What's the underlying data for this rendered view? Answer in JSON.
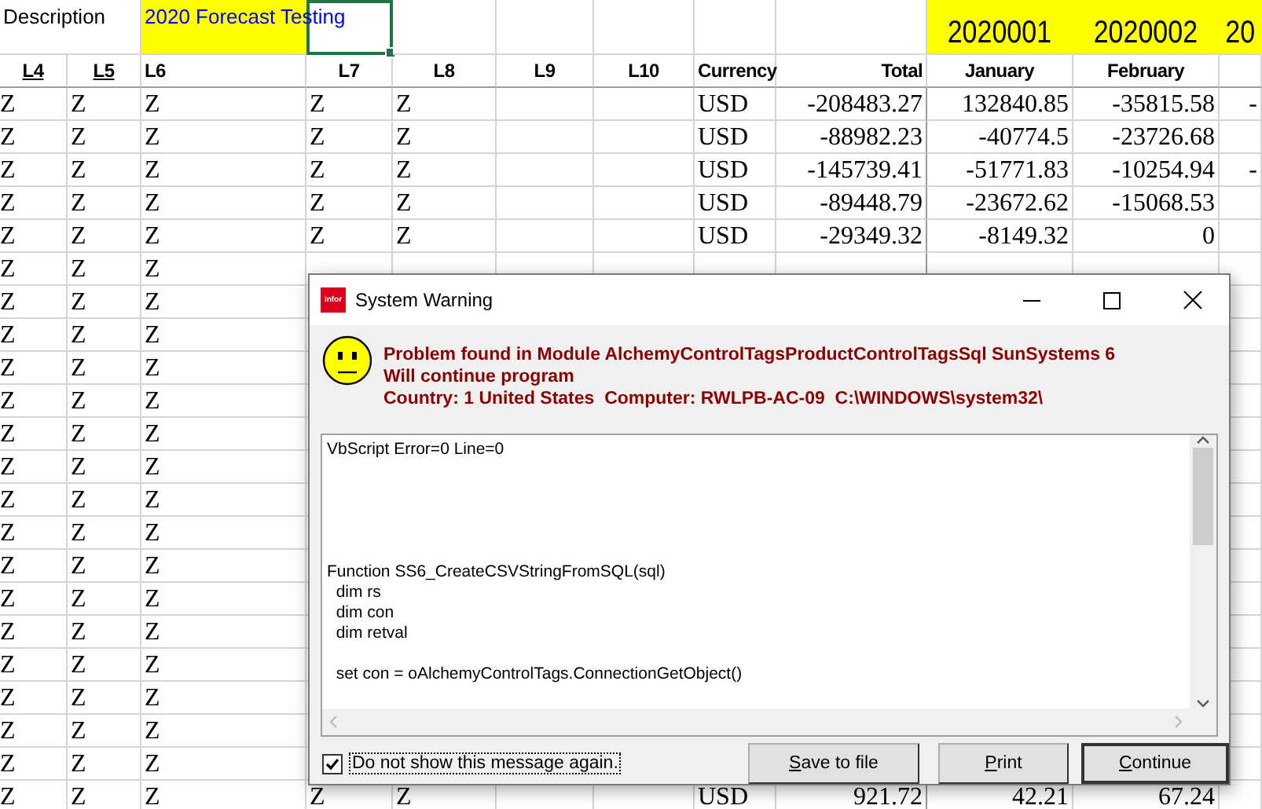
{
  "sheet": {
    "top_row": [
      {
        "text": "Description",
        "highlighted": false,
        "selected": false
      },
      {
        "text": "2020 Forecast Testing",
        "highlighted": true,
        "selected": false
      },
      {
        "highlighted": false,
        "selected": true
      },
      {
        "highlighted": false,
        "selected": false
      },
      {
        "highlighted": false,
        "selected": false
      },
      {
        "highlighted": false,
        "selected": false
      },
      {
        "highlighted": false,
        "selected": false
      },
      {
        "highlighted": false,
        "selected": false
      },
      {
        "text": "2020001",
        "highlighted": true,
        "selected": false
      },
      {
        "text": "2020002",
        "highlighted": true,
        "selected": false
      },
      {
        "text": "20",
        "highlighted": true,
        "selected": false
      }
    ],
    "columns": [
      {
        "label": "L4",
        "underlined": true
      },
      {
        "label": "L5",
        "underlined": true
      },
      {
        "label": "L6",
        "underlined": false
      },
      {
        "label": "L7",
        "underlined": false
      },
      {
        "label": "L8",
        "underlined": false
      },
      {
        "label": "L9",
        "underlined": false
      },
      {
        "label": "L10",
        "underlined": false
      },
      {
        "label": "Currency",
        "underlined": false
      },
      {
        "label": "Total",
        "underlined": false
      },
      {
        "label": "January",
        "underlined": false
      },
      {
        "label": "February",
        "underlined": false
      }
    ],
    "rows": [
      [
        "Z",
        "Z",
        "Z",
        "Z",
        "Z",
        null,
        null,
        "USD",
        "-208483.27",
        "132840.85",
        "-35815.58",
        "-"
      ],
      [
        "Z",
        "Z",
        "Z",
        "Z",
        "Z",
        null,
        null,
        "USD",
        "-88982.23",
        "-40774.5",
        "-23726.68",
        null
      ],
      [
        "Z",
        "Z",
        "Z",
        "Z",
        "Z",
        null,
        null,
        "USD",
        "-145739.41",
        "-51771.83",
        "-10254.94",
        "-"
      ],
      [
        "Z",
        "Z",
        "Z",
        "Z",
        "Z",
        null,
        null,
        "USD",
        "-89448.79",
        "-23672.62",
        "-15068.53",
        null
      ],
      [
        "Z",
        "Z",
        "Z",
        "Z",
        "Z",
        null,
        null,
        "USD",
        "-29349.32",
        "-8149.32",
        "0",
        null
      ],
      [
        "Z",
        "Z",
        "Z",
        null,
        null,
        null,
        null,
        null,
        null,
        null,
        null,
        null
      ],
      [
        "Z",
        "Z",
        "Z",
        null,
        null,
        null,
        null,
        null,
        null,
        null,
        null,
        null
      ],
      [
        "Z",
        "Z",
        "Z",
        null,
        null,
        null,
        null,
        null,
        null,
        null,
        null,
        null
      ],
      [
        "Z",
        "Z",
        "Z",
        null,
        null,
        null,
        null,
        null,
        null,
        null,
        null,
        null
      ],
      [
        "Z",
        "Z",
        "Z",
        null,
        null,
        null,
        null,
        null,
        null,
        null,
        null,
        null
      ],
      [
        "Z",
        "Z",
        "Z",
        null,
        null,
        null,
        null,
        null,
        null,
        null,
        null,
        null
      ],
      [
        "Z",
        "Z",
        "Z",
        null,
        null,
        null,
        null,
        null,
        null,
        null,
        null,
        null
      ],
      [
        "Z",
        "Z",
        "Z",
        null,
        null,
        null,
        null,
        null,
        null,
        null,
        null,
        null
      ],
      [
        "Z",
        "Z",
        "Z",
        null,
        null,
        null,
        null,
        null,
        null,
        null,
        null,
        null
      ],
      [
        "Z",
        "Z",
        "Z",
        null,
        null,
        null,
        null,
        null,
        null,
        null,
        null,
        null
      ],
      [
        "Z",
        "Z",
        "Z",
        null,
        null,
        null,
        null,
        null,
        null,
        null,
        null,
        null
      ],
      [
        "Z",
        "Z",
        "Z",
        null,
        null,
        null,
        null,
        null,
        null,
        null,
        null,
        null
      ],
      [
        "Z",
        "Z",
        "Z",
        null,
        null,
        null,
        null,
        null,
        null,
        null,
        null,
        null
      ],
      [
        "Z",
        "Z",
        "Z",
        null,
        null,
        null,
        null,
        null,
        null,
        null,
        null,
        null
      ],
      [
        "Z",
        "Z",
        "Z",
        null,
        null,
        null,
        null,
        null,
        null,
        null,
        null,
        null
      ],
      [
        "Z",
        "Z",
        "Z",
        null,
        null,
        null,
        null,
        null,
        null,
        null,
        null,
        null
      ],
      [
        "Z",
        "Z",
        "Z",
        "Z",
        "Z",
        null,
        null,
        "USD",
        "921.72",
        "42.21",
        "67.24",
        null
      ]
    ]
  },
  "dialog": {
    "app_icon_text": "infor",
    "title": "System Warning",
    "message_lines": [
      "Problem found in Module AlchemyControlTagsProductControlTagsSql SunSystems 6",
      "Will continue program",
      "Country: 1 United States  Computer: RWLPB-AC-09  C:\\WINDOWS\\system32\\"
    ],
    "details": "VbScript Error=0 Line=0\n\n\n\n\n\nFunction SS6_CreateCSVStringFromSQL(sql)\n  dim rs\n  dim con\n  dim retval\n\n  set con = oAlchemyControlTags.ConnectionGetObject()",
    "checkbox": {
      "label": "Do not show this message again.",
      "checked": true
    },
    "buttons": [
      {
        "label": "Save to file",
        "default": false
      },
      {
        "label": "Print",
        "default": false
      },
      {
        "label": "Continue",
        "default": true
      }
    ]
  }
}
